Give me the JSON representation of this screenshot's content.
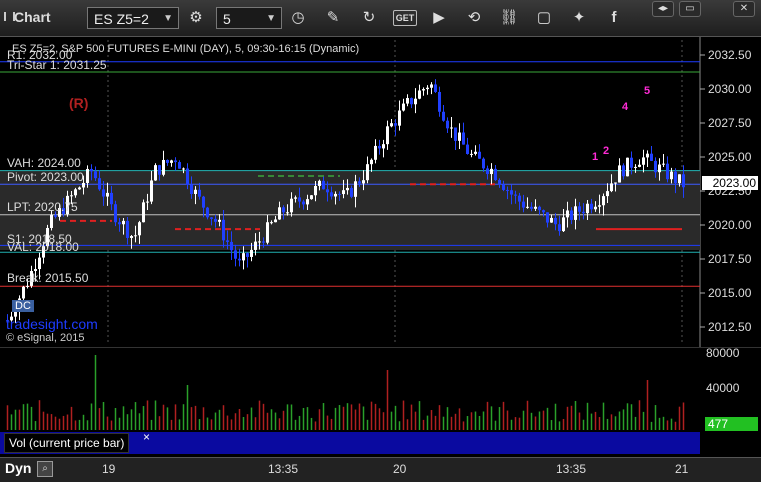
{
  "toolbar": {
    "title": "Chart",
    "symbol": "ES Z5=2",
    "interval": "5",
    "icons": [
      "pencil-icon",
      "refresh-icon",
      "get-icon",
      "play-icon",
      "refresh-circle-icon",
      "link-icon",
      "chat-icon",
      "twitter-icon",
      "facebook-icon"
    ],
    "window_buttons": [
      "◂▸",
      "▭",
      "✕"
    ]
  },
  "chart": {
    "header": "ES Z5=2, S&P 500 FUTURES E-MINI (DAY), 5, 09:30-16:15 (Dynamic)",
    "copyright": "© eSignal, 2015",
    "watermark": "tradesight.com",
    "current_price": "2023.00",
    "price_ticks": [
      "2032.50",
      "2030.00",
      "2027.50",
      "2025.00",
      "2022.50",
      "2020.00",
      "2017.50",
      "2015.00",
      "2012.50"
    ],
    "levels": [
      {
        "label": "R1: 2032.00",
        "color": "#1e3cff"
      },
      {
        "label": "Tri-Star 1: 2031.25",
        "color": "#3aa83a"
      },
      {
        "label": "VAH: 2024.00",
        "color": "#20b0b0"
      },
      {
        "label": "Pivot: 2023.00",
        "color": "#3d5bff"
      },
      {
        "label": "LPT: 2020.75",
        "color": "#c0c0c0"
      },
      {
        "label": "S1: 2018.50",
        "color": "#1e3cff"
      },
      {
        "label": "VAL: 2018.00",
        "color": "#20b0b0"
      },
      {
        "label": "Break: 2015.50",
        "color": "#e03030"
      }
    ],
    "annotations": {
      "r_marker": "(R)",
      "magenta_counts": [
        "1",
        "2",
        "4",
        "5"
      ],
      "dc_badge": "DC"
    }
  },
  "volume": {
    "ticks": [
      "80000",
      "40000"
    ],
    "current": "477",
    "label": "Vol (current price bar)",
    "close": "×"
  },
  "footer": {
    "mode": "Dyn",
    "time_labels": [
      "19",
      "13:35",
      "20",
      "13:35",
      "21"
    ]
  }
}
